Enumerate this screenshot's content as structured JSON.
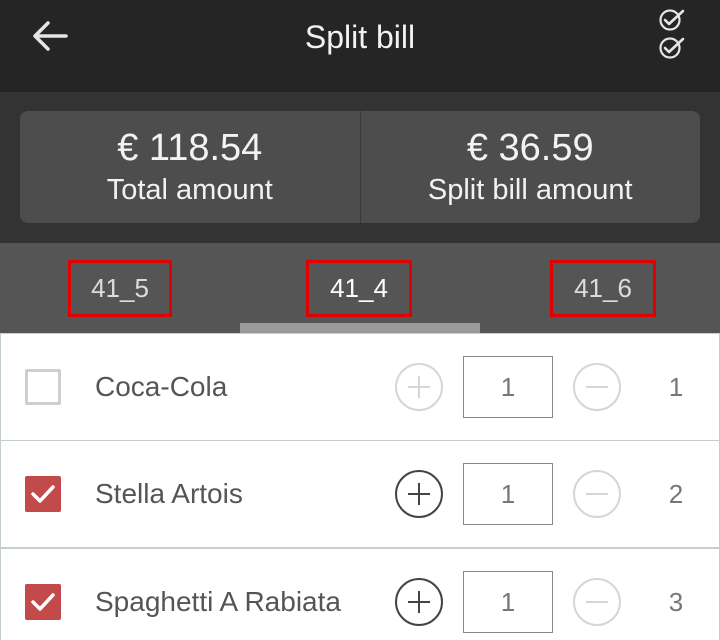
{
  "header": {
    "title": "Split bill",
    "back_icon": "arrow-left-icon",
    "check_all_icon": "double-check-icon"
  },
  "summary": {
    "total_amount": "€ 118.54",
    "total_label": "Total amount",
    "split_amount": "€ 36.59",
    "split_label": "Split bill amount"
  },
  "tabs": [
    {
      "label": "41_5",
      "active": false
    },
    {
      "label": "41_4",
      "active": true
    },
    {
      "label": "41_6",
      "active": false
    }
  ],
  "items": [
    {
      "name": "Coca-Cola",
      "checked": false,
      "quantity": "1",
      "count": "1"
    },
    {
      "name": "Stella Artois",
      "checked": true,
      "quantity": "1",
      "count": "2"
    },
    {
      "name": "Spaghetti A Rabiata",
      "checked": true,
      "quantity": "1",
      "count": "3"
    }
  ],
  "colors": {
    "header_bg": "#252525",
    "summary_card": "#4d4d4d",
    "tab_bar": "#555555",
    "tab_highlight_border": "#e00000",
    "checkbox_checked": "#c24a4a"
  }
}
